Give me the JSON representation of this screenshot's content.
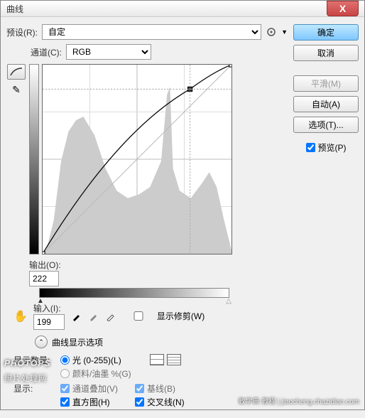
{
  "title": "曲线",
  "preset": {
    "label": "预设(R):",
    "value": "自定"
  },
  "channel": {
    "label": "通道(C):",
    "value": "RGB"
  },
  "output": {
    "label": "输出(O):",
    "value": "222"
  },
  "input": {
    "label": "输入(I):",
    "value": "199"
  },
  "show_clip": "显示修剪(W)",
  "expand": "曲线显示选项",
  "amount_label": "显示数量:",
  "amount_opts": {
    "light": "光 (0-255)(L)",
    "pigment": "颜料/油墨 %(G)"
  },
  "show_label": "显示:",
  "show_opts": {
    "channel_overlay": "通道叠加(V)",
    "baseline": "基线(B)",
    "histogram": "直方图(H)",
    "intersection": "交叉线(N)"
  },
  "buttons": {
    "ok": "确定",
    "cancel": "取消",
    "smooth": "平滑(M)",
    "auto": "自动(A)",
    "options": "选项(T)...",
    "preview": "预览(P)"
  },
  "watermark1": "PHOTOPS",
  "watermark_sub": "照片处理网",
  "watermark2": "教学典  教程 | jiaocheng.chazidian.com",
  "chart_data": {
    "type": "line",
    "title": "",
    "xlabel": "输入",
    "ylabel": "输出",
    "xlim": [
      0,
      255
    ],
    "ylim": [
      0,
      255
    ],
    "series": [
      {
        "name": "curve",
        "x": [
          0,
          199,
          255
        ],
        "y": [
          0,
          222,
          255
        ]
      },
      {
        "name": "baseline",
        "x": [
          0,
          255
        ],
        "y": [
          0,
          255
        ]
      }
    ],
    "current_point": {
      "input": 199,
      "output": 222
    }
  }
}
